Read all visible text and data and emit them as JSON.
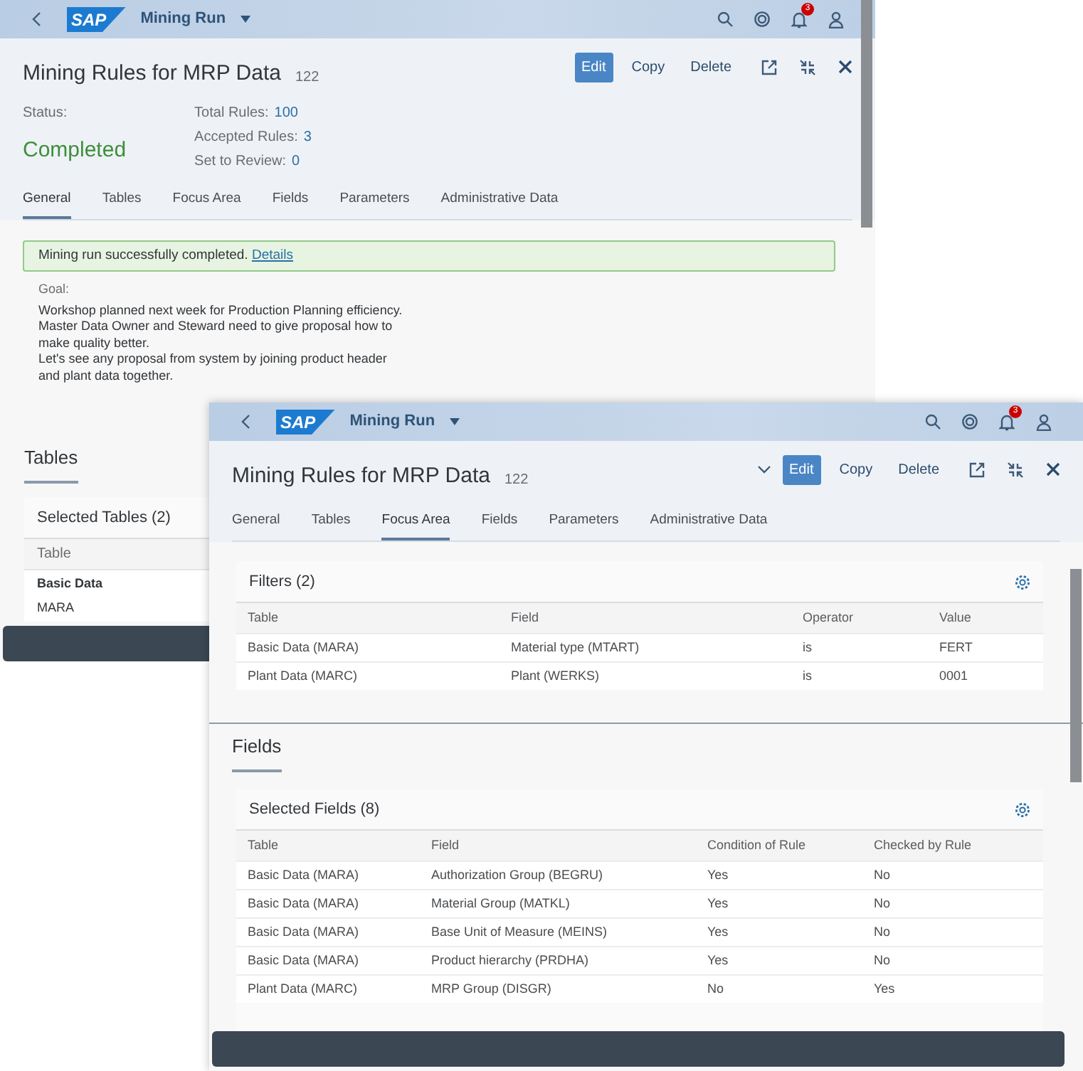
{
  "back_window": {
    "shell": {
      "logo": "SAP",
      "title": "Mining Run",
      "notifications": "3"
    },
    "header": {
      "title": "Mining Rules for MRP Data",
      "count": "122",
      "actions": [
        {
          "label": "Edit",
          "emphasized": true
        },
        {
          "label": "Copy",
          "emphasized": false
        },
        {
          "label": "Delete",
          "emphasized": false
        }
      ],
      "status_label": "Status:",
      "status": "Completed",
      "kpis": [
        {
          "label": "Total Rules:",
          "value": "100"
        },
        {
          "label": "Accepted Rules:",
          "value": "3"
        },
        {
          "label": "Set to Review:",
          "value": "0"
        }
      ]
    },
    "tabs": [
      {
        "label": "General",
        "selected": true
      },
      {
        "label": "Tables",
        "selected": false
      },
      {
        "label": "Focus Area",
        "selected": false
      },
      {
        "label": "Fields",
        "selected": false
      },
      {
        "label": "Parameters",
        "selected": false
      },
      {
        "label": "Administrative Data",
        "selected": false
      }
    ],
    "message": {
      "text": "Mining run successfully completed.",
      "link": "Details"
    },
    "goal": {
      "label": "Goal:",
      "lines": [
        "Workshop planned next week for Production Planning efficiency.",
        "Master Data Owner and Steward need to give proposal how to make quality better.",
        "Let's see any proposal from system by joining product header and plant data together."
      ]
    },
    "tables_section": {
      "title": "Tables",
      "card_title": "Selected Tables (2)",
      "column": "Table",
      "group": "Basic Data",
      "row": "MARA"
    }
  },
  "front_window": {
    "shell": {
      "logo": "SAP",
      "title": "Mining Run",
      "notifications": "3"
    },
    "header": {
      "title": "Mining Rules for MRP Data",
      "count": "122",
      "collapsible": true,
      "actions": [
        {
          "label": "Edit",
          "emphasized": true
        },
        {
          "label": "Copy",
          "emphasized": false
        },
        {
          "label": "Delete",
          "emphasized": false
        }
      ]
    },
    "tabs": [
      {
        "label": "General",
        "selected": false
      },
      {
        "label": "Tables",
        "selected": false
      },
      {
        "label": "Focus Area",
        "selected": true
      },
      {
        "label": "Fields",
        "selected": false
      },
      {
        "label": "Parameters",
        "selected": false
      },
      {
        "label": "Administrative Data",
        "selected": false
      }
    ],
    "filters": {
      "title": "Filters (2)",
      "columns": [
        "Table",
        "Field",
        "Operator",
        "Value"
      ],
      "rows": [
        [
          "Basic Data (MARA)",
          "Material type (MTART)",
          "is",
          "FERT"
        ],
        [
          "Plant Data (MARC)",
          "Plant (WERKS)",
          "is",
          "0001"
        ]
      ]
    },
    "fields": {
      "section_title": "Fields",
      "card_title": "Selected Fields (8)",
      "columns": [
        "Table",
        "Field",
        "Condition of Rule",
        "Checked by Rule"
      ],
      "rows": [
        [
          "Basic Data (MARA)",
          "Authorization Group (BEGRU)",
          "Yes",
          "No"
        ],
        [
          "Basic Data (MARA)",
          "Material Group (MATKL)",
          "Yes",
          "No"
        ],
        [
          "Basic Data (MARA)",
          "Base Unit of Measure (MEINS)",
          "Yes",
          "No"
        ],
        [
          "Basic Data (MARA)",
          "Product hierarchy (PRDHA)",
          "Yes",
          "No"
        ],
        [
          "Plant Data (MARC)",
          "MRP Group (DISGR)",
          "No",
          "Yes"
        ]
      ]
    }
  }
}
